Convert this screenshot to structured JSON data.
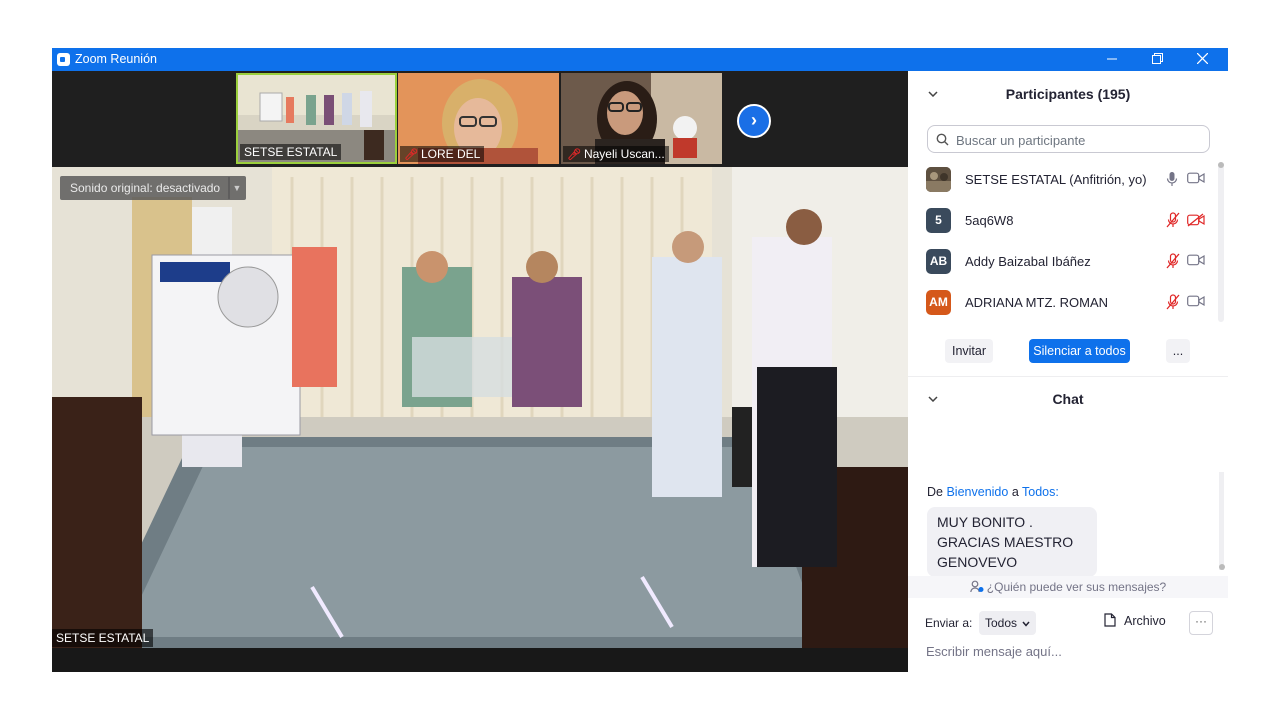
{
  "window": {
    "title": "Zoom Reunión",
    "minimize_icon": "minimize-icon",
    "restore_icon": "restore-icon",
    "close_icon": "close-icon"
  },
  "thumbnails": [
    {
      "name": "SETSE ESTATAL",
      "muted": false,
      "active": true
    },
    {
      "name": "LORE DEL",
      "muted": true,
      "active": false
    },
    {
      "name": "Nayeli Uscan...",
      "muted": true,
      "active": false
    }
  ],
  "main_video": {
    "sound_button": "Sonido original: desactivado",
    "speaker_name": "SETSE ESTATAL"
  },
  "participants": {
    "title": "Participantes (195)",
    "search_placeholder": "Buscar un participante",
    "list": [
      {
        "initials": "",
        "name": "SETSE ESTATAL (Anfitrión, yo)",
        "avatar_color": "#6b5a45",
        "mic": "on",
        "video": "on"
      },
      {
        "initials": "5",
        "name": "5aq6W8",
        "avatar_color": "#3a4a5c",
        "mic": "muted",
        "video": "off"
      },
      {
        "initials": "AB",
        "name": "Addy Baizabal Ibáñez",
        "avatar_color": "#3a4a5c",
        "mic": "muted",
        "video": "on"
      },
      {
        "initials": "AM",
        "name": "ADRIANA MTZ. ROMAN",
        "avatar_color": "#d5581a",
        "mic": "muted",
        "video": "on"
      }
    ],
    "invite_label": "Invitar",
    "mute_all_label": "Silenciar a todos",
    "more_label": "..."
  },
  "chat": {
    "title": "Chat",
    "from_prefix": "De",
    "from_name": "Bienvenido",
    "to_word": "a",
    "to_name": "Todos:",
    "messages": [
      {
        "text": "MUY BONITO . GRACIAS MAESTRO GENOVEVO"
      }
    ],
    "who_can_see": "¿Quién puede ver sus mensajes?",
    "send_to_label": "Enviar a:",
    "send_to_value": "Todos",
    "file_label": "Archivo",
    "more_label": "···",
    "input_placeholder": "Escribir mensaje aquí..."
  },
  "colors": {
    "zoom_blue": "#0e71eb",
    "muted_red": "#e02828",
    "panel_text": "#232333"
  }
}
